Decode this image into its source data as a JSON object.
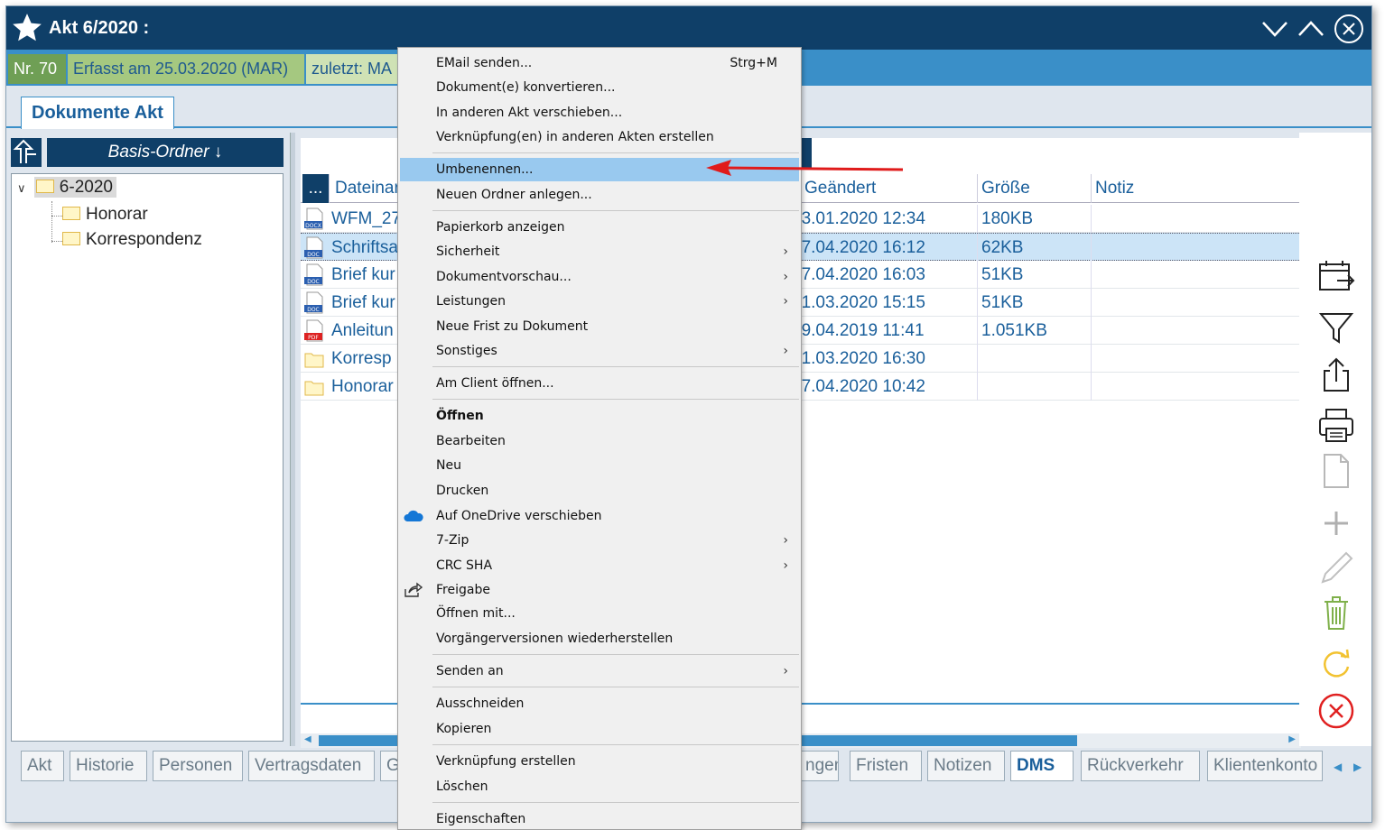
{
  "window": {
    "title": "Akt 6/2020 :",
    "info": {
      "nr": "Nr. 70",
      "erfasst": "Erfasst am 25.03.2020 (MAR)",
      "zuletzt": "zuletzt: MA"
    },
    "tab_title": "Dokumente Akt"
  },
  "left": {
    "basis_label": "Basis-Ordner ↓",
    "tree": [
      {
        "label": "6-2020"
      },
      {
        "label": "Honorar"
      },
      {
        "label": "Korrespondenz"
      }
    ]
  },
  "grid": {
    "columns": [
      "...",
      "Dateinar",
      "Geändert",
      "Größe",
      "Notiz"
    ],
    "rows": [
      {
        "name": "WFM_27",
        "type": "DOCX",
        "changed": "23.01.2020 12:34",
        "size": "180KB",
        "note": ""
      },
      {
        "name": "Schriftsa",
        "type": "DOC",
        "changed": "07.04.2020 16:12",
        "size": "62KB",
        "note": "",
        "selected": true
      },
      {
        "name": "Brief kur",
        "type": "DOC",
        "changed": "07.04.2020 16:03",
        "size": "51KB",
        "note": ""
      },
      {
        "name": "Brief kur",
        "type": "DOC",
        "changed": "31.03.2020 15:15",
        "size": "51KB",
        "note": ""
      },
      {
        "name": "Anleitun",
        "type": "PDF",
        "changed": "09.04.2019 11:41",
        "size": "1.051KB",
        "note": ""
      },
      {
        "name": "Korresp",
        "type": "folder",
        "changed": "31.03.2020 16:30",
        "size": "",
        "note": ""
      },
      {
        "name": "Honorar",
        "type": "folder",
        "changed": "07.04.2020 10:42",
        "size": "",
        "note": ""
      }
    ]
  },
  "context_menu": {
    "items": [
      {
        "label": "EMail senden...",
        "shortcut": "Strg+M"
      },
      {
        "label": "Dokument(e) konvertieren..."
      },
      {
        "label": "In anderen Akt verschieben..."
      },
      {
        "label": "Verknüpfung(en) in anderen Akten erstellen"
      },
      {
        "label": "Umbenennen...",
        "highlighted": true
      },
      {
        "label": "Neuen Ordner anlegen..."
      },
      {
        "label": "Papierkorb anzeigen"
      },
      {
        "label": "Sicherheit",
        "submenu": true
      },
      {
        "label": "Dokumentvorschau...",
        "submenu": true
      },
      {
        "label": "Leistungen",
        "submenu": true
      },
      {
        "label": "Neue Frist zu Dokument"
      },
      {
        "label": "Sonstiges",
        "submenu": true
      },
      {
        "label": "Am Client öffnen..."
      },
      {
        "label": "Öffnen",
        "bold": true
      },
      {
        "label": "Bearbeiten"
      },
      {
        "label": "Neu"
      },
      {
        "label": "Drucken"
      },
      {
        "label": "Auf OneDrive verschieben",
        "icon": "onedrive-icon"
      },
      {
        "label": "7-Zip",
        "submenu": true
      },
      {
        "label": "CRC SHA",
        "submenu": true
      },
      {
        "label": "Freigabe",
        "icon": "share-icon"
      },
      {
        "label": "Öffnen mit..."
      },
      {
        "label": "Vorgängerversionen wiederherstellen"
      },
      {
        "label": "Senden an",
        "submenu": true
      },
      {
        "label": "Ausschneiden"
      },
      {
        "label": "Kopieren"
      },
      {
        "label": "Verknüpfung erstellen"
      },
      {
        "label": "Löschen"
      },
      {
        "label": "Eigenschaften"
      }
    ]
  },
  "bottom_tabs": [
    "Akt",
    "Historie",
    "Personen",
    "Vertragsdaten",
    "G",
    "ngen",
    "Fristen",
    "Notizen",
    "DMS",
    "Rückverkehr",
    "Klientenkonto"
  ],
  "active_tab": "DMS",
  "colors": {
    "titlebar": "#0f3f68",
    "accent": "#3a8fc8",
    "highlight": "#99c9ef",
    "arrow": "#e01b1b"
  },
  "right_toolbar_icons": [
    "calendar-export-icon",
    "filter-icon",
    "upload-icon",
    "print-icon",
    "new-document-icon",
    "add-icon",
    "edit-icon",
    "trash-icon",
    "refresh-icon",
    "close-circle-icon"
  ]
}
